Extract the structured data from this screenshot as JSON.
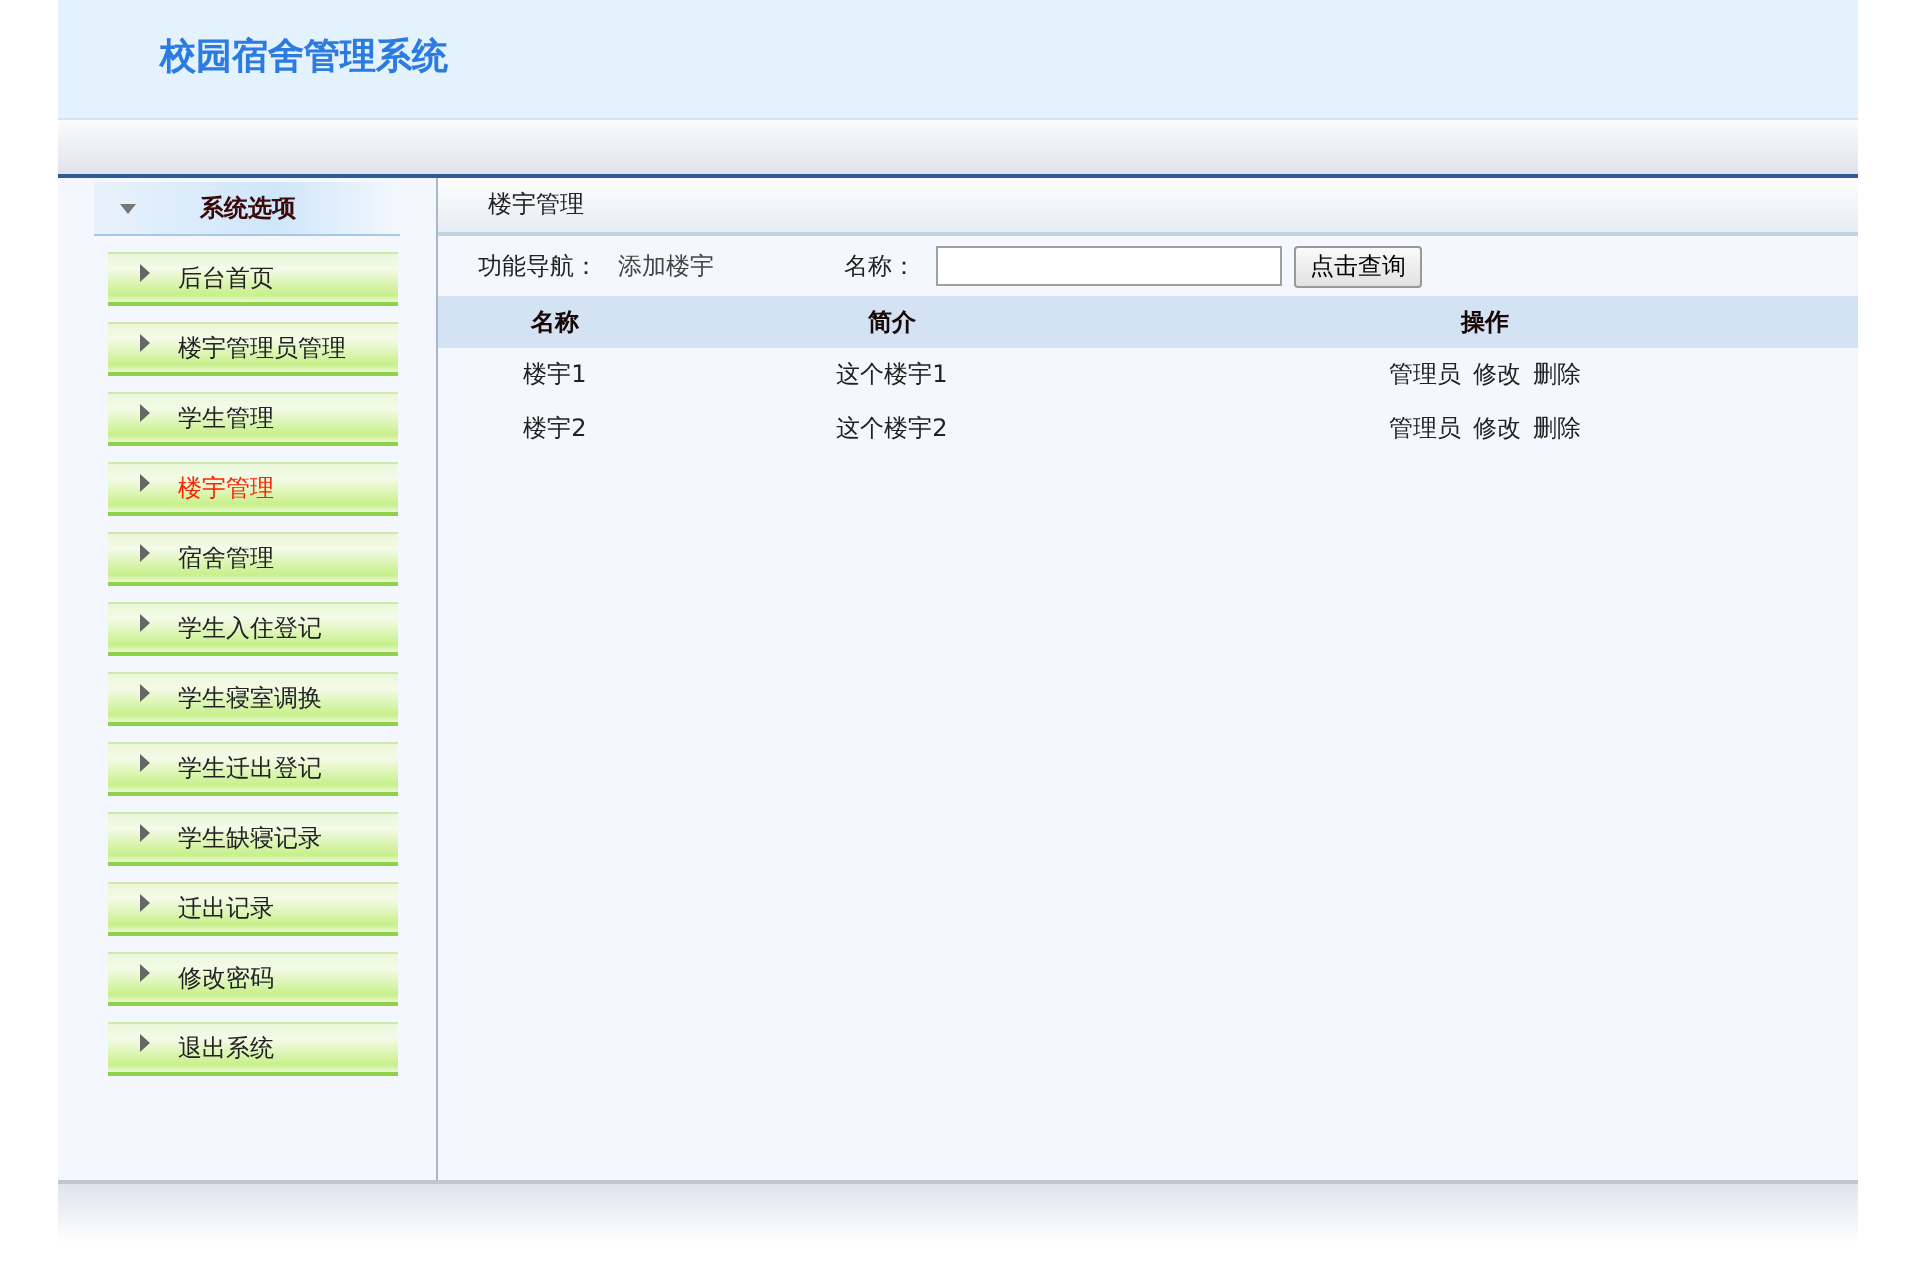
{
  "header": {
    "title": "校园宿舍管理系统"
  },
  "sidebar": {
    "title": "系统选项",
    "items": [
      {
        "label": "后台首页",
        "selected": false
      },
      {
        "label": "楼宇管理员管理",
        "selected": false
      },
      {
        "label": "学生管理",
        "selected": false
      },
      {
        "label": "楼宇管理",
        "selected": true
      },
      {
        "label": "宿舍管理",
        "selected": false
      },
      {
        "label": "学生入住登记",
        "selected": false
      },
      {
        "label": "学生寝室调换",
        "selected": false
      },
      {
        "label": "学生迁出登记",
        "selected": false
      },
      {
        "label": "学生缺寝记录",
        "selected": false
      },
      {
        "label": "迁出记录",
        "selected": false
      },
      {
        "label": "修改密码",
        "selected": false
      },
      {
        "label": "退出系统",
        "selected": false
      }
    ]
  },
  "content": {
    "title": "楼宇管理",
    "nav_label": "功能导航：",
    "nav_link": "添加楼宇",
    "search_label": "名称：",
    "search_button": "点击查询",
    "table": {
      "columns": [
        "名称",
        "简介",
        "操作"
      ],
      "rows": [
        {
          "name": "楼宇1",
          "intro": "这个楼宇1",
          "actions": [
            "管理员",
            "修改",
            "删除"
          ]
        },
        {
          "name": "楼宇2",
          "intro": "这个楼宇2",
          "actions": [
            "管理员",
            "修改",
            "删除"
          ]
        }
      ]
    }
  }
}
